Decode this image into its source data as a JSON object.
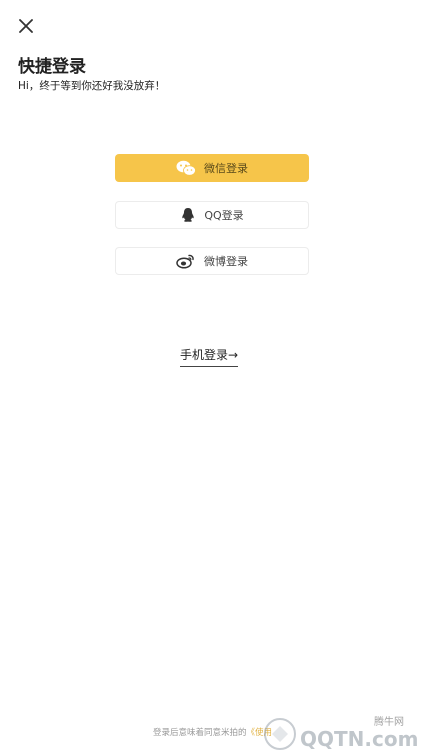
{
  "header": {
    "close_icon": "close-icon",
    "title": "快捷登录",
    "subtitle": "Hi，终于等到你还好我没放弃！"
  },
  "login_options": {
    "wechat": {
      "label": "微信登录",
      "icon": "wechat-icon",
      "color": "#f6c54a"
    },
    "qq": {
      "label": "QQ登录",
      "icon": "qq-icon"
    },
    "weibo": {
      "label": "微博登录",
      "icon": "weibo-icon"
    }
  },
  "phone_login": {
    "label": "手机登录→"
  },
  "footer": {
    "text": "登录后意味着同意米拍的",
    "link": "《使用"
  },
  "watermark": {
    "site": "腾牛网",
    "logo_text": "QQTN.com"
  }
}
